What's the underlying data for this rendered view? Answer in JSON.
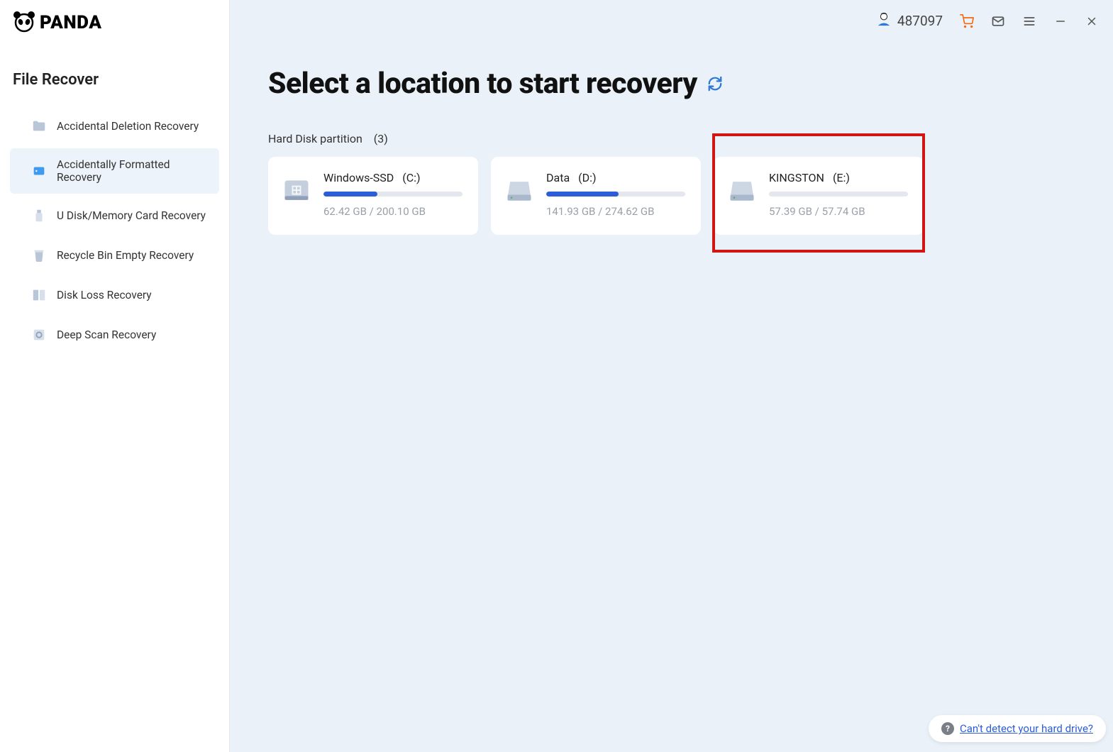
{
  "logo_text": "PANDA",
  "sidebar": {
    "title": "File Recover",
    "items": [
      {
        "label": "Accidental Deletion Recovery",
        "icon": "folder-icon",
        "active": false
      },
      {
        "label": "Accidentally Formatted Recovery",
        "icon": "drive-format-icon",
        "active": true
      },
      {
        "label": "U Disk/Memory Card Recovery",
        "icon": "usb-icon",
        "active": false
      },
      {
        "label": "Recycle Bin Empty Recovery",
        "icon": "trash-icon",
        "active": false
      },
      {
        "label": "Disk Loss Recovery",
        "icon": "disk-loss-icon",
        "active": false
      },
      {
        "label": "Deep Scan Recovery",
        "icon": "deep-scan-icon",
        "active": false
      }
    ]
  },
  "topbar": {
    "user_id": "487097"
  },
  "main": {
    "title": "Select a location to start recovery",
    "section_label": "Hard Disk partition",
    "count": "(3)",
    "help_link": "Can't detect your hard drive?"
  },
  "drives": [
    {
      "name": "Windows-SSD",
      "letter": "(C:)",
      "usage": "62.42 GB / 200.10 GB",
      "pct": 39,
      "kind": "system"
    },
    {
      "name": "Data",
      "letter": "(D:)",
      "usage": "141.93 GB / 274.62 GB",
      "pct": 52,
      "kind": "data",
      "highlight": true
    },
    {
      "name": "KINGSTON",
      "letter": "(E:)",
      "usage": "57.39 GB / 57.74 GB",
      "pct": 0,
      "kind": "data"
    }
  ]
}
